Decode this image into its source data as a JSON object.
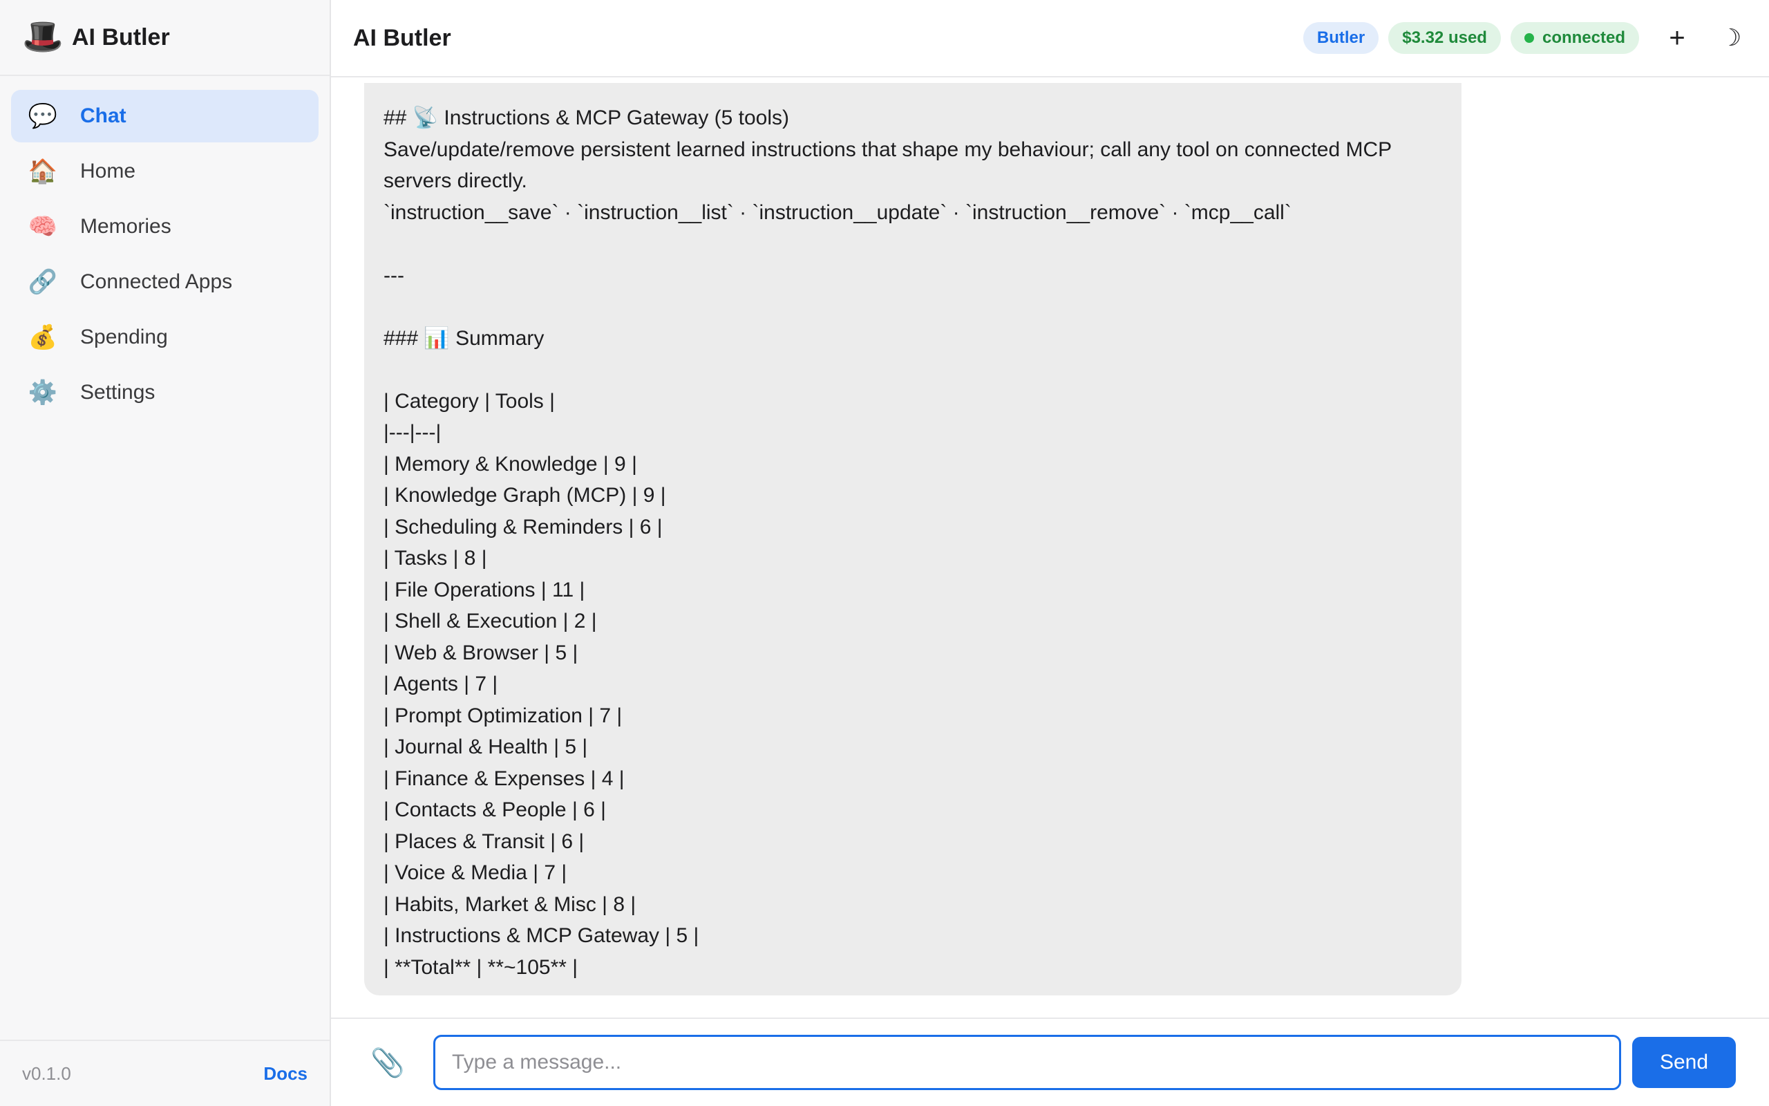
{
  "app": {
    "name": "AI Butler",
    "brand_icon": "🎩"
  },
  "sidebar": {
    "items": [
      {
        "label": "Chat",
        "icon": "💬",
        "icon_name": "chat-bubble-icon",
        "active": true
      },
      {
        "label": "Home",
        "icon": "🏠",
        "icon_name": "house-icon",
        "active": false
      },
      {
        "label": "Memories",
        "icon": "🧠",
        "icon_name": "brain-icon",
        "active": false
      },
      {
        "label": "Connected Apps",
        "icon": "🔗",
        "icon_name": "link-icon",
        "active": false
      },
      {
        "label": "Spending",
        "icon": "💰",
        "icon_name": "money-bag-icon",
        "active": false
      },
      {
        "label": "Settings",
        "icon": "⚙️",
        "icon_name": "gear-icon",
        "active": false
      }
    ],
    "version": "v0.1.0",
    "docs_label": "Docs"
  },
  "header": {
    "title": "AI Butler",
    "agent_badge": "Butler",
    "cost_badge": "$3.32 used",
    "status_badge": "connected",
    "new_chat_icon": "+",
    "theme_icon": "☽"
  },
  "message": {
    "lines": [
      "## 📡 Instructions & MCP Gateway (5 tools)",
      "Save/update/remove persistent learned instructions that shape my behaviour; call any tool on connected MCP",
      "servers directly.",
      "`instruction__save` · `instruction__list` · `instruction__update` · `instruction__remove` · `mcp__call`",
      "",
      "---",
      "",
      "### 📊 Summary",
      "",
      "| Category | Tools |",
      "|---|---|",
      "| Memory & Knowledge | 9 |",
      "| Knowledge Graph (MCP) | 9 |",
      "| Scheduling & Reminders | 6 |",
      "| Tasks | 8 |",
      "| File Operations | 11 |",
      "| Shell & Execution | 2 |",
      "| Web & Browser | 5 |",
      "| Agents | 7 |",
      "| Prompt Optimization | 7 |",
      "| Journal & Health | 5 |",
      "| Finance & Expenses | 4 |",
      "| Contacts & People | 6 |",
      "| Places & Transit | 6 |",
      "| Voice & Media | 7 |",
      "| Habits, Market & Misc | 8 |",
      "| Instructions & MCP Gateway | 5 |",
      "| **Total** | **~105** |"
    ]
  },
  "composer": {
    "placeholder": "Type a message...",
    "value": "",
    "send_label": "Send",
    "attach_icon": "📎"
  },
  "colors": {
    "accent": "#1a6ee8",
    "success": "#1f8a3b",
    "bubble_bg": "#ececec"
  }
}
